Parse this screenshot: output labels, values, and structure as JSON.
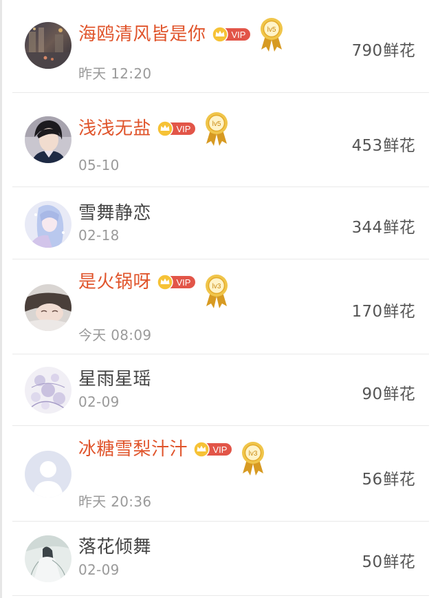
{
  "supporters": [
    {
      "name": "海鸥清风皆是你",
      "vip": true,
      "vip_label": "VIP",
      "level": "lv5",
      "time": "昨天 12:20",
      "flower_count": "790",
      "flower_unit": "鲜花",
      "avatar": "city-night-avatar"
    },
    {
      "name": "浅浅无盐",
      "vip": true,
      "vip_label": "VIP",
      "level": "lv5",
      "time": "05-10",
      "flower_count": "453",
      "flower_unit": "鲜花",
      "avatar": "young-man-avatar"
    },
    {
      "name": "雪舞静恋",
      "vip": false,
      "time": "02-18",
      "flower_count": "344",
      "flower_unit": "鲜花",
      "avatar": "anime-girl-avatar"
    },
    {
      "name": "是火锅呀",
      "vip": true,
      "vip_label": "VIP",
      "level": "lv3",
      "time": "今天 08:09",
      "flower_count": "170",
      "flower_unit": "鲜花",
      "avatar": "sleeping-girl-avatar"
    },
    {
      "name": "星雨星瑶",
      "vip": false,
      "time": "02-09",
      "flower_count": "90",
      "flower_unit": "鲜花",
      "avatar": "floral-art-avatar"
    },
    {
      "name": "冰糖雪梨汁汁",
      "vip": true,
      "vip_label": "VIP",
      "level": "lv3",
      "time": "昨天 20:36",
      "flower_count": "56",
      "flower_unit": "鲜花",
      "avatar": "default-user-avatar"
    },
    {
      "name": "落花倾舞",
      "vip": false,
      "time": "02-09",
      "flower_count": "50",
      "flower_unit": "鲜花",
      "avatar": "ink-figure-avatar"
    }
  ],
  "colors": {
    "vip_name": "#e0542b",
    "plain_name": "#444444",
    "vip_badge_bg": "#e25548",
    "crown_gold": "#f2b21b",
    "medal_gold": "#e9b431",
    "time_text": "#9a9a9a",
    "flower_text": "#555555"
  }
}
